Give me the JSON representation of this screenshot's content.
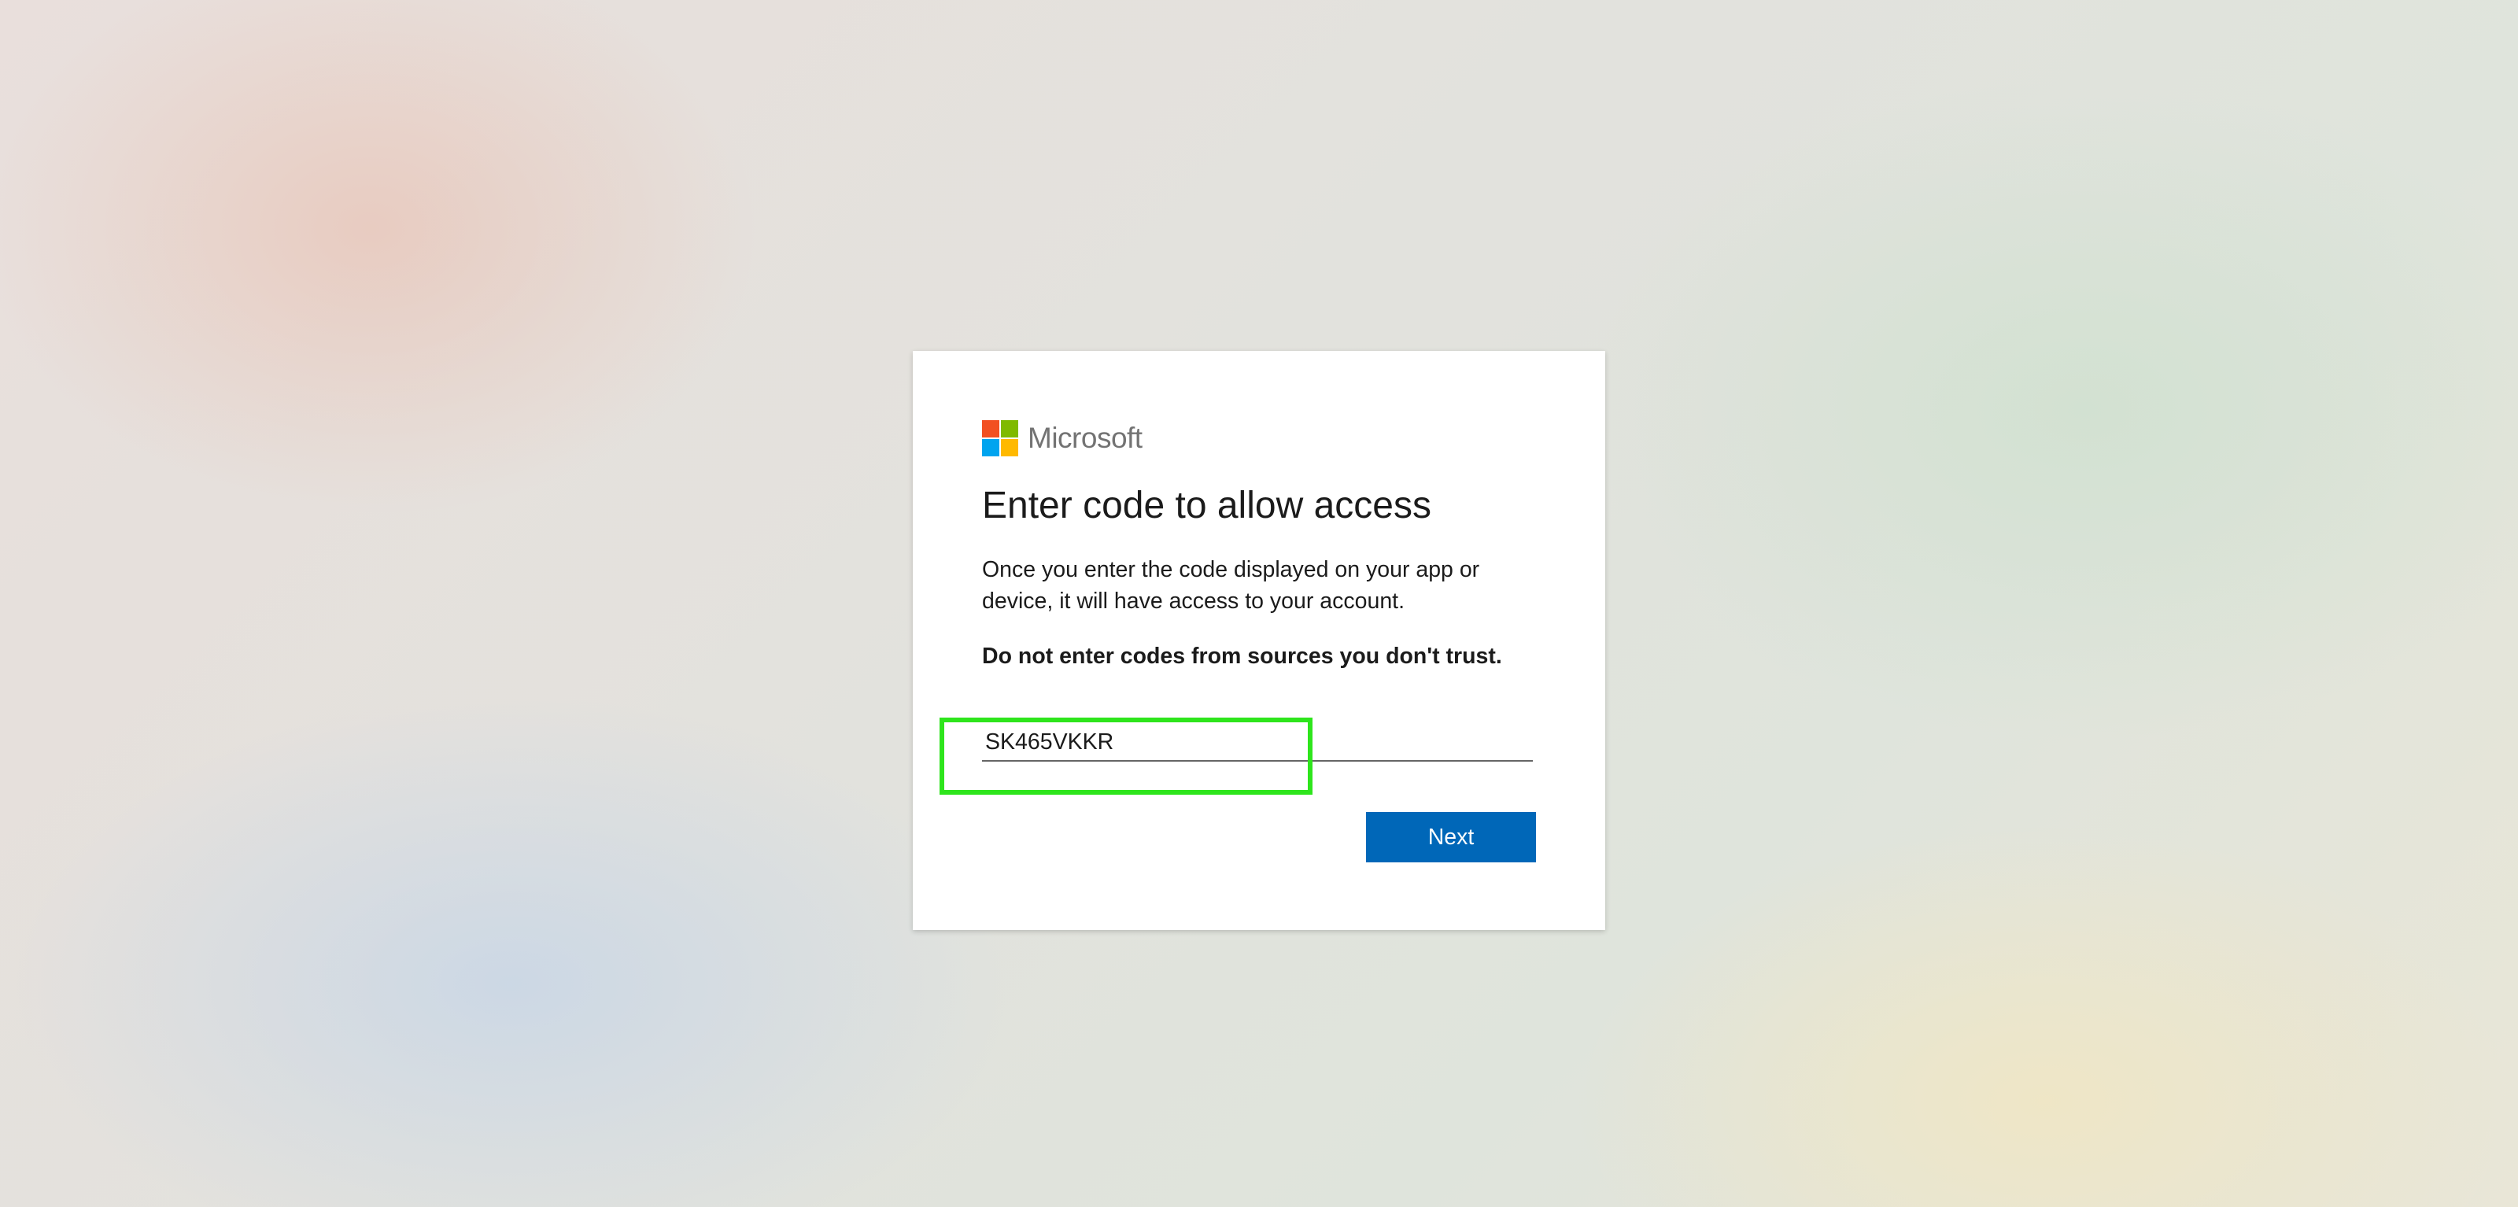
{
  "logo": {
    "brand_text": "Microsoft",
    "colors": {
      "red": "#f25022",
      "green": "#7fba00",
      "blue": "#00a4ef",
      "yellow": "#ffb900"
    }
  },
  "dialog": {
    "title": "Enter code to allow access",
    "description": "Once you enter the code displayed on your app or device, it will have access to your account.",
    "warning": "Do not enter codes from sources you don't trust.",
    "code_input": {
      "value": "SK465VKKR"
    },
    "next_button_label": "Next"
  },
  "colors": {
    "accent": "#0067b8",
    "highlight": "#2ee51c",
    "text": "#1b1b1b"
  }
}
